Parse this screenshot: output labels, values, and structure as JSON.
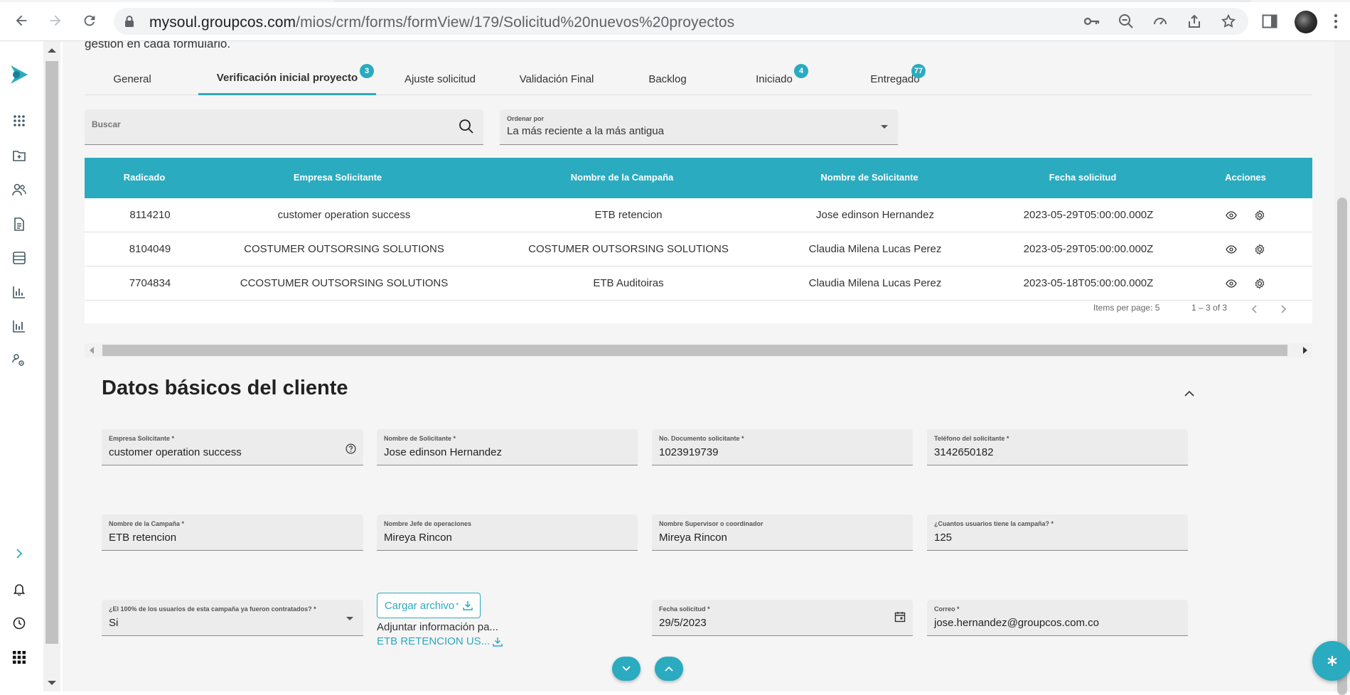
{
  "browser": {
    "url_host": "mysoul.groupcos.com",
    "url_path": "/mios/crm/forms/formView/179/Solicitud%20nuevos%20proyectos"
  },
  "main": {
    "topnote": "gestion en cada formulario.",
    "tabs": [
      {
        "label": "General"
      },
      {
        "label": "Verificación inicial proyecto",
        "badge": "3",
        "active": true
      },
      {
        "label": "Ajuste solicitud"
      },
      {
        "label": "Validación Final"
      },
      {
        "label": "Backlog"
      },
      {
        "label": "Iniciado",
        "badge": "4"
      },
      {
        "label": "Entregado",
        "badge": "77"
      }
    ],
    "search": {
      "placeholder": "Buscar"
    },
    "sort": {
      "label": "Ordenar por",
      "value": "La más reciente a la más antigua"
    },
    "table": {
      "headers": [
        "Radicado",
        "Empresa Solicitante",
        "Nombre de la Campaña",
        "Nombre de Solicitante",
        "Fecha solicitud",
        "Acciones"
      ],
      "rows": [
        [
          "8114210",
          "customer operation success",
          "ETB retencion",
          "Jose edinson Hernandez",
          "2023-05-29T05:00:00.000Z"
        ],
        [
          "8104049",
          "COSTUMER OUTSORSING SOLUTIONS",
          "COSTUMER OUTSORSING SOLUTIONS",
          "Claudia Milena Lucas Perez",
          "2023-05-29T05:00:00.000Z"
        ],
        [
          "7704834",
          "CCOSTUMER OUTSORSING SOLUTIONS",
          "ETB Auditoiras",
          "Claudia Milena Lucas Perez",
          "2023-05-18T05:00:00.000Z"
        ]
      ],
      "items_per_page": "Items per page: 5",
      "range": "1 – 3 of 3"
    },
    "section": {
      "title": "Datos básicos del cliente",
      "fields": [
        {
          "label": "Empresa Solicitante *",
          "value": "customer operation success"
        },
        {
          "label": "Nombre de Solicitante *",
          "value": "Jose edinson Hernandez"
        },
        {
          "label": "No. Documento solicitante *",
          "value": "1023919739"
        },
        {
          "label": "Teléfono del solicitante *",
          "value": "3142650182"
        },
        {
          "label": "Nombre de la Campaña *",
          "value": "ETB retencion"
        },
        {
          "label": "Nombre Jefe de operaciones",
          "value": "Mireya Rincon"
        },
        {
          "label": "Nombre Supervisor o coordinador",
          "value": "Mireya Rincon"
        },
        {
          "label": "¿Cuantos usuarios tiene la campaña? *",
          "value": "125"
        },
        {
          "label": "¿El 100% de los usuarios de esta campaña ya fueron contratados? *",
          "value": "Si"
        },
        {
          "label": "Fecha solicitud *",
          "value": "29/5/2023"
        },
        {
          "label": "Correo *",
          "value": "jose.hernandez@groupcos.com.co"
        }
      ],
      "upload_label": "Cargar archivo",
      "upload_required": "*",
      "adjunto_text": "Adjuntar información pa...",
      "file_name": "ETB RETENCION US..."
    }
  },
  "colors": {
    "accent": "#2aabbf"
  }
}
